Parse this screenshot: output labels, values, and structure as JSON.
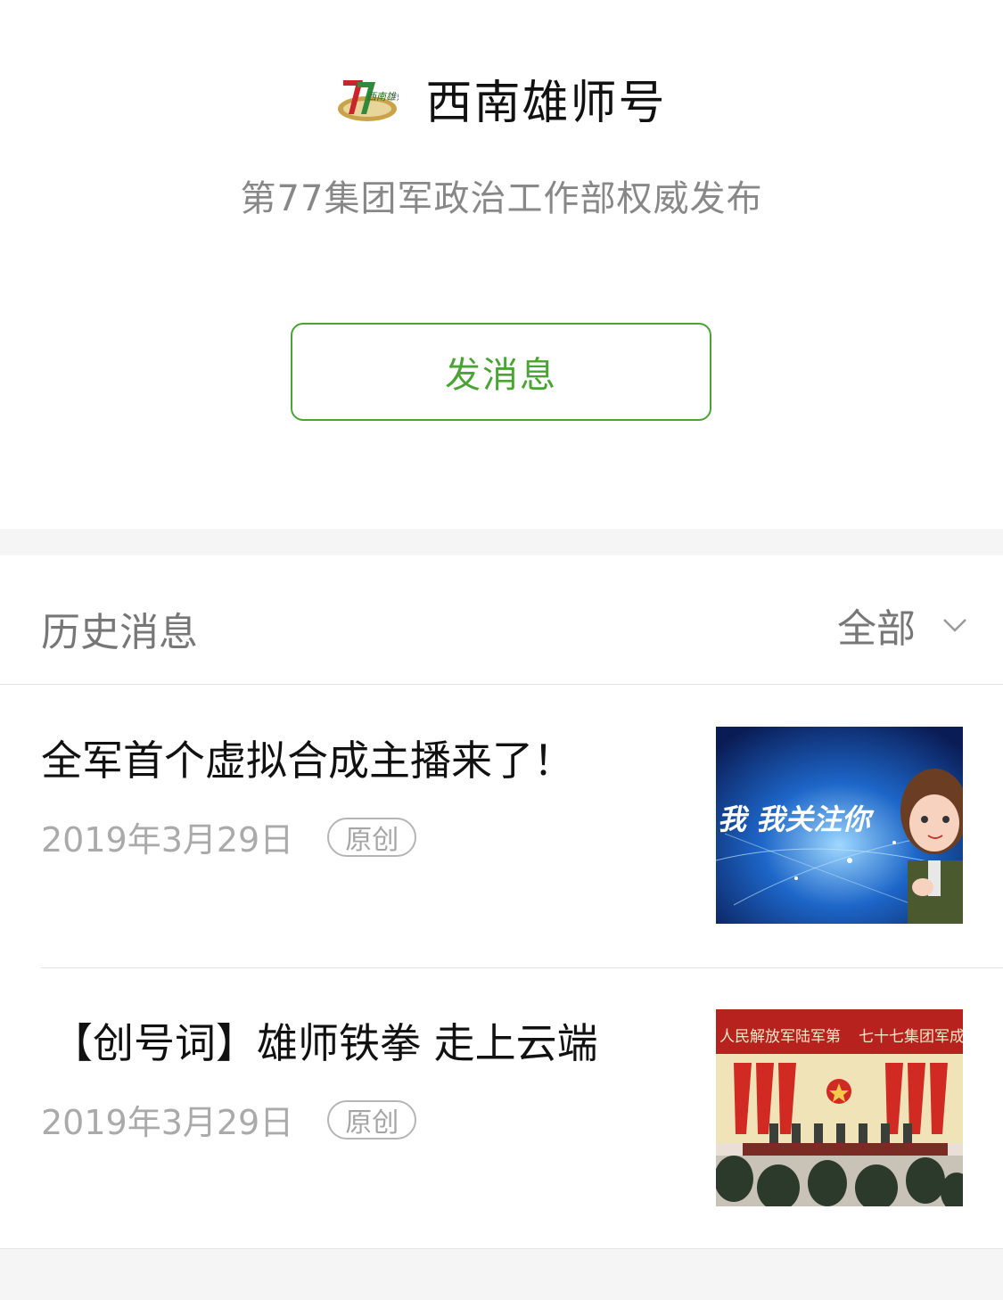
{
  "header": {
    "account_name": "西南雄师号",
    "description": "第77集团军政治工作部权威发布",
    "send_message_label": "发消息",
    "logo_text": "西南雄师"
  },
  "history": {
    "title": "历史消息",
    "filter_label": "全部"
  },
  "articles": [
    {
      "title": "全军首个虚拟合成主播来了！",
      "date": "2019年3月29日",
      "badge": "原创",
      "thumb_text": "我 我关注你"
    },
    {
      "title": "【创号词】雄师铁拳 走上云端",
      "date": "2019年3月29日",
      "badge": "原创",
      "thumb_text_left": "人民解放军陆军第",
      "thumb_text_right": "七十七集团军成立大"
    }
  ],
  "colors": {
    "accent_green": "#4aa435",
    "text_primary": "#111111",
    "text_secondary": "#888888",
    "divider": "#e2e2e2",
    "band": "#f5f5f5"
  }
}
